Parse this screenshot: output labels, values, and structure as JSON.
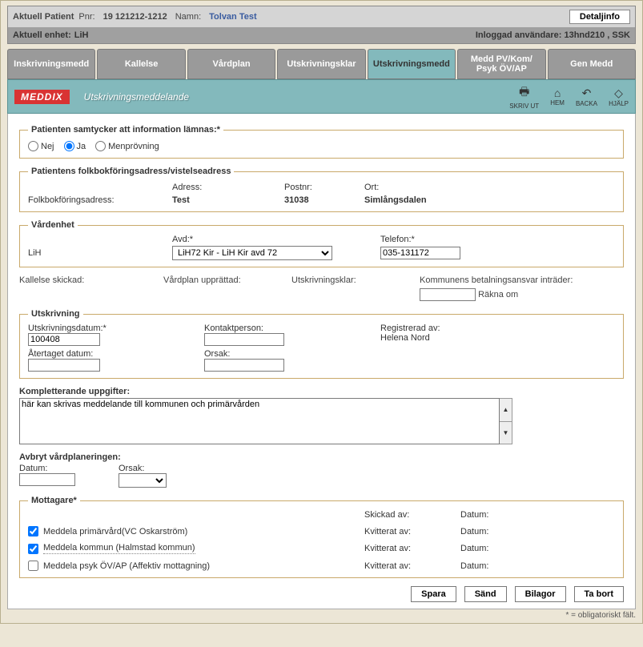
{
  "header": {
    "patient_label": "Aktuell Patient",
    "pnr_label": "Pnr:",
    "pnr_value": "19 121212-1212",
    "name_label": "Namn:",
    "name_value": "Tolvan Test",
    "detail_btn": "Detaljinfo",
    "enhet_label": "Aktuell enhet:",
    "enhet_value": "LiH",
    "login_label": "Inloggad användare:",
    "login_value": "13hnd210 , SSK"
  },
  "tabs": {
    "t1": "Inskrivningsmedd",
    "t2": "Kallelse",
    "t3": "Vårdplan",
    "t4": "Utskrivningsklar",
    "t5": "Utskrivningsmedd",
    "t6": "Medd PV/Kom/\nPsyk ÖV/AP",
    "t7": "Gen Medd"
  },
  "toolbar": {
    "brand": "MEDDIX",
    "title": "Utskrivningsmeddelande",
    "icons": {
      "print": "SKRIV UT",
      "home": "HEM",
      "back": "BACKA",
      "help": "HJÄLP"
    }
  },
  "consent": {
    "legend": "Patienten samtycker att information lämnas:*",
    "opt_nej": "Nej",
    "opt_ja": "Ja",
    "opt_men": "Menprövning"
  },
  "addr": {
    "legend": "Patientens folkbokföringsadress/vistelseadress",
    "col_adress": "Adress:",
    "col_postnr": "Postnr:",
    "col_ort": "Ort:",
    "row_label": "Folkbokföringsadress:",
    "adress_val": "Test",
    "postnr_val": "31038",
    "ort_val": "Simlångsdalen"
  },
  "vard": {
    "legend": "Vårdenhet",
    "unit": "LiH",
    "avd_label": "Avd:*",
    "avd_value": "LiH72 Kir - LiH Kir avd 72",
    "tel_label": "Telefon:*",
    "tel_value": "035-131172"
  },
  "status": {
    "kallelse": "Kallelse skickad:",
    "vardplan": "Vårdplan upprättad:",
    "utklar": "Utskrivningsklar:",
    "betal": "Kommunens betalningsansvar inträder:",
    "rakna": "Räkna om"
  },
  "utskr": {
    "legend": "Utskrivning",
    "datum_label": "Utskrivningsdatum:*",
    "datum_value": "100408",
    "kontakt_label": "Kontaktperson:",
    "kontakt_value": "",
    "reg_label": "Registrerad av:",
    "reg_value": "Helena Nord",
    "atertag_label": "Återtaget datum:",
    "atertag_value": "",
    "orsak_label": "Orsak:",
    "orsak_value": ""
  },
  "komp": {
    "label": "Kompletterande uppgifter:",
    "value": "här kan skrivas meddelande till kommunen och primärvården"
  },
  "avbryt": {
    "title": "Avbryt vårdplaneringen:",
    "datum_label": "Datum:",
    "datum_value": "",
    "orsak_label": "Orsak:",
    "orsak_value": ""
  },
  "mott": {
    "legend": "Mottagare*",
    "skickad": "Skickad av:",
    "datum": "Datum:",
    "kvitterat": "Kvitterat av:",
    "r1": "Meddela primärvård(VC Oskarström)",
    "r2": "Meddela kommun (Halmstad kommun)",
    "r3": "Meddela psyk ÖV/AP (Affektiv mottagning)"
  },
  "buttons": {
    "spara": "Spara",
    "sand": "Sänd",
    "bilagor": "Bilagor",
    "tabort": "Ta bort"
  },
  "footnote": "* = obligatoriskt fält."
}
